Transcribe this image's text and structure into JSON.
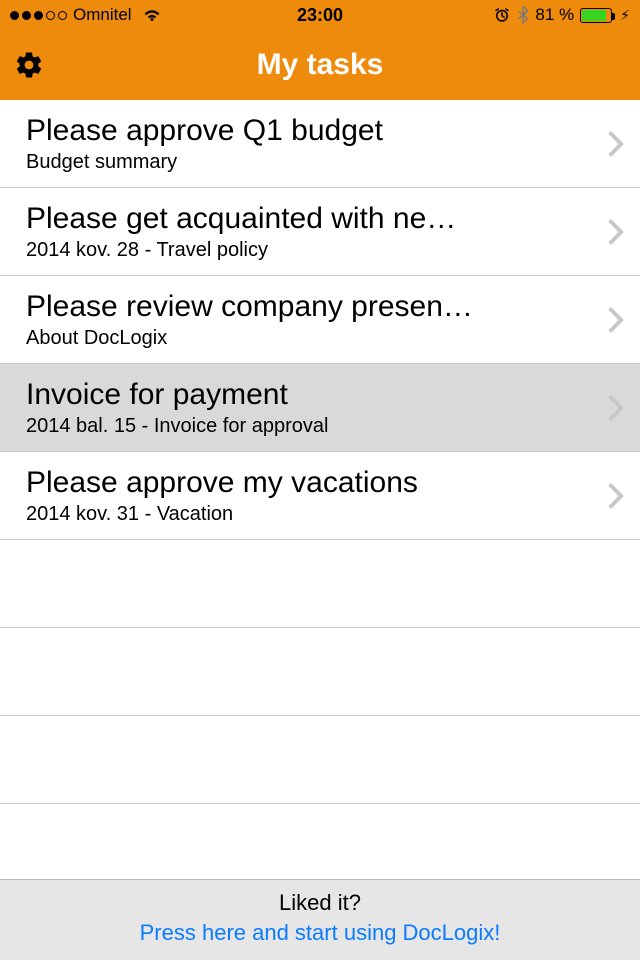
{
  "statusBar": {
    "carrier": "Omnitel",
    "time": "23:00",
    "batteryPct": "81 %"
  },
  "nav": {
    "title": "My tasks"
  },
  "tasks": [
    {
      "title": "Please approve Q1 budget",
      "subtitle": "Budget summary",
      "selected": false
    },
    {
      "title": "Please get acquainted with ne…",
      "subtitle": "2014 kov. 28 - Travel policy",
      "selected": false
    },
    {
      "title": "Please review company presen…",
      "subtitle": "About DocLogix",
      "selected": false
    },
    {
      "title": "Invoice for payment",
      "subtitle": "2014 bal. 15 - Invoice for approval",
      "selected": true
    },
    {
      "title": "Please approve my vacations",
      "subtitle": "2014 kov. 31 - Vacation",
      "selected": false
    }
  ],
  "footer": {
    "line1": "Liked it?",
    "line2": "Press here and start using DocLogix!"
  }
}
